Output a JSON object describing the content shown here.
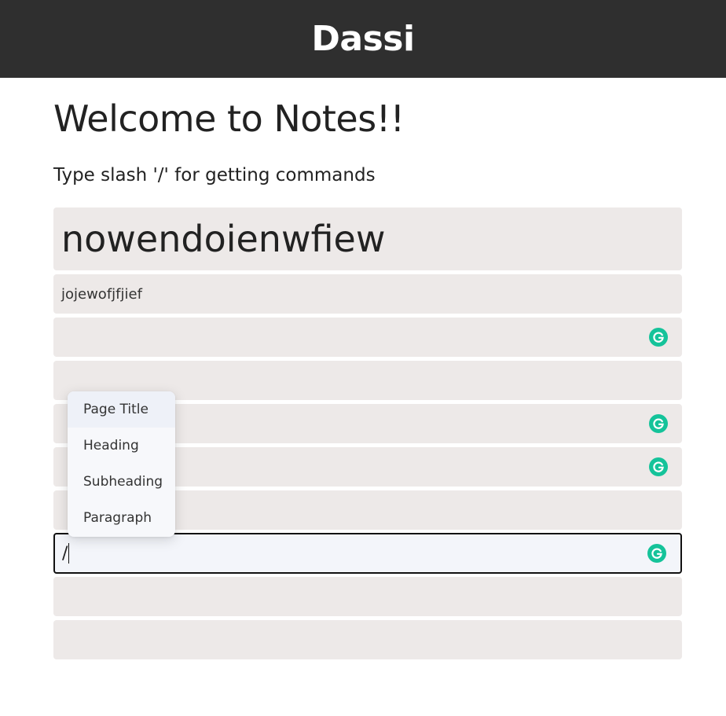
{
  "header": {
    "brand": "Dassi"
  },
  "page": {
    "title": "Welcome to Notes!!",
    "subtitle": "Type slash '/' for getting commands"
  },
  "blocks": [
    {
      "type": "title",
      "text": "nowendoienwfiew"
    },
    {
      "type": "paragraph",
      "text": "jojewofjfjief"
    },
    {
      "type": "empty",
      "text": "",
      "icon": "grammarly-icon"
    },
    {
      "type": "empty",
      "text": ""
    },
    {
      "type": "empty",
      "text": "",
      "icon": "grammarly-icon"
    },
    {
      "type": "empty",
      "text": "",
      "icon": "grammarly-icon"
    },
    {
      "type": "empty",
      "text": ""
    },
    {
      "type": "active",
      "text": "/",
      "icon": "grammarly-icon"
    },
    {
      "type": "empty",
      "text": ""
    },
    {
      "type": "empty",
      "text": ""
    }
  ],
  "command_menu": {
    "items": [
      "Page Title",
      "Heading",
      "Subheading",
      "Paragraph"
    ],
    "highlighted": "Page Title"
  },
  "colors": {
    "header_bg": "#2f2f2f",
    "block_bg": "#ede9e8",
    "active_block_bg": "#f3f5fa",
    "grammarly_green": "#15c39a"
  }
}
